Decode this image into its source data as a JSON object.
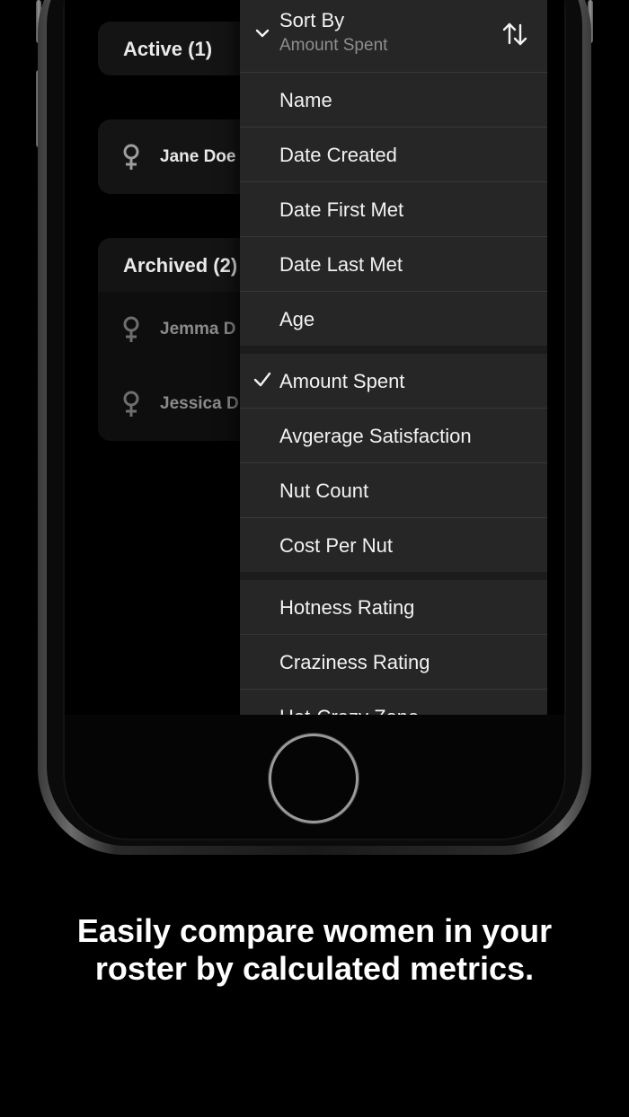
{
  "screen": {
    "groups": [
      {
        "header": "Active (1)",
        "rows": [
          {
            "name": "Jane Doe",
            "icon": "female-symbol-icon"
          }
        ]
      },
      {
        "header": "Archived (2)",
        "rows": [
          {
            "name": "Jemma D",
            "icon": "female-symbol-icon"
          },
          {
            "name": "Jessica D",
            "icon": "female-symbol-icon"
          }
        ]
      }
    ]
  },
  "sort_menu": {
    "title": "Sort By",
    "current_value": "Amount Spent",
    "direction_icon": "sort-direction-icon",
    "items": [
      {
        "label": "Name",
        "checked": false
      },
      {
        "label": "Date Created",
        "checked": false
      },
      {
        "label": "Date First Met",
        "checked": false
      },
      {
        "label": "Date Last Met",
        "checked": false
      },
      {
        "label": "Age",
        "checked": false
      },
      {
        "label": "Amount Spent",
        "checked": true
      },
      {
        "label": "Avgerage Satisfaction",
        "checked": false
      },
      {
        "label": "Nut Count",
        "checked": false
      },
      {
        "label": "Cost Per Nut",
        "checked": false
      },
      {
        "label": "Hotness Rating",
        "checked": false
      },
      {
        "label": "Craziness Rating",
        "checked": false
      },
      {
        "label": "Hot-Crazy Zone",
        "checked": false
      }
    ]
  },
  "caption": {
    "line1": "Easily compare women in your",
    "line2": "roster by calculated metrics."
  },
  "colors": {
    "background": "#000000",
    "menu_bg": "#262626",
    "menu_text": "#f2f2f2",
    "menu_subtext": "#8e8e8e"
  }
}
